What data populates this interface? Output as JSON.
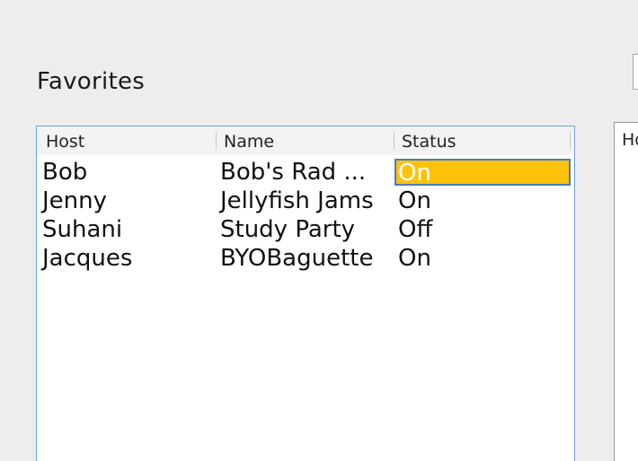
{
  "favorites": {
    "title": "Favorites",
    "columns": [
      "Host",
      "Name",
      "Status"
    ],
    "rows": [
      {
        "host": "Bob",
        "name": "Bob's Rad ...",
        "status": "On",
        "selected": true
      },
      {
        "host": "Jenny",
        "name": "Jellyfish Jams",
        "status": "On",
        "selected": false
      },
      {
        "host": "Suhani",
        "name": "Study Party",
        "status": "Off",
        "selected": false
      },
      {
        "host": "Jacques",
        "name": "BYOBaguette",
        "status": "On",
        "selected": false
      }
    ]
  },
  "right_panel": {
    "header_partial": "Ho"
  },
  "colors": {
    "selection_fill": "#fdc20c",
    "selection_border": "#4a7bc0",
    "focus_border": "#6ea6e0",
    "background": "#ededed"
  }
}
